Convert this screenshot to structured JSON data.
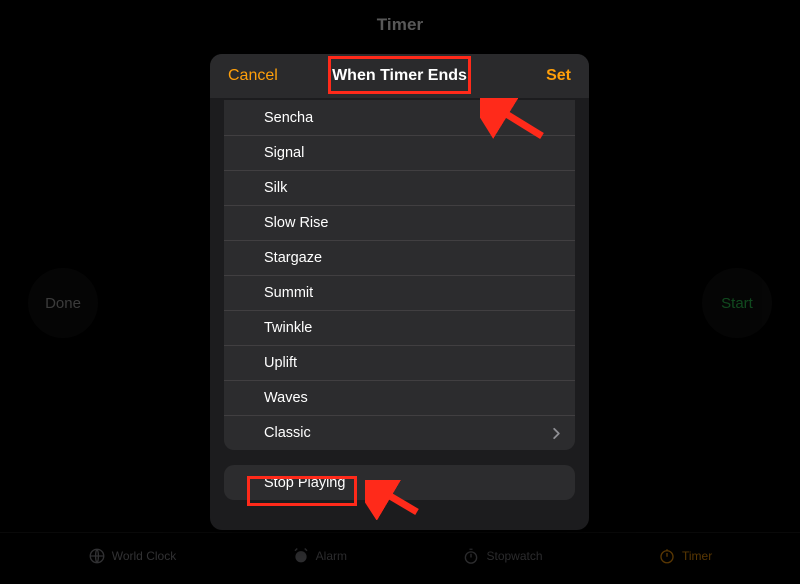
{
  "app": {
    "title": "Timer"
  },
  "side_buttons": {
    "left": "Done",
    "right": "Start"
  },
  "sheet": {
    "cancel": "Cancel",
    "title": "When Timer Ends",
    "set": "Set",
    "sounds": [
      "Sencha",
      "Signal",
      "Silk",
      "Slow Rise",
      "Stargaze",
      "Summit",
      "Twinkle",
      "Uplift",
      "Waves",
      "Classic"
    ],
    "stop_playing": "Stop Playing"
  },
  "tabs": {
    "world_clock": "World Clock",
    "alarm": "Alarm",
    "stopwatch": "Stopwatch",
    "timer": "Timer"
  },
  "colors": {
    "accent": "#ff9f0a",
    "start_green": "#30d158",
    "highlight_red": "#ff2a1a"
  }
}
